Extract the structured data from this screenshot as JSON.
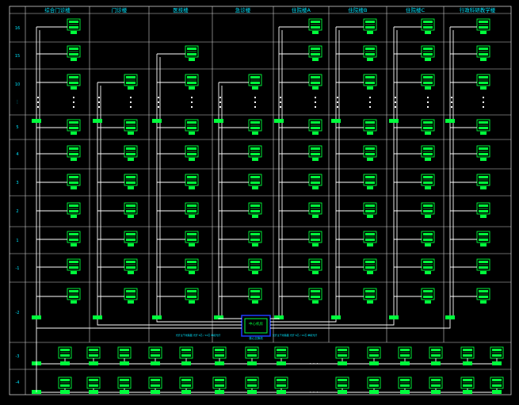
{
  "columns": [
    {
      "id": "c1",
      "label": "综合门诊楼"
    },
    {
      "id": "c2",
      "label": "门诊楼"
    },
    {
      "id": "c3",
      "label": "医技楼"
    },
    {
      "id": "c4",
      "label": "急诊楼"
    },
    {
      "id": "c5",
      "label": "住院楼A"
    },
    {
      "id": "c6",
      "label": "住院楼B"
    },
    {
      "id": "c7",
      "label": "住院楼C"
    },
    {
      "id": "c8",
      "label": "行政科研教学楼"
    }
  ],
  "floors": [
    "16",
    "15",
    "10",
    "⋮",
    "5",
    "4",
    "3",
    "2",
    "1",
    "-1",
    "-2",
    "-3",
    "-4"
  ],
  "center": {
    "label": "中心机房",
    "sub": "核心交换机"
  },
  "notes": {
    "left": "光纤主干线路图 光纤 6芯 / 12芯 单模光纤",
    "right": "光纤主干线路图 光纤 6芯 / 12芯 单模光纤"
  },
  "dots": "· · ·",
  "colors": {
    "grid": "#cfcfcf",
    "cyan": "#00e5ff",
    "green": "#00ff3c",
    "blue": "#1f3cff",
    "line": "#ffffff"
  }
}
